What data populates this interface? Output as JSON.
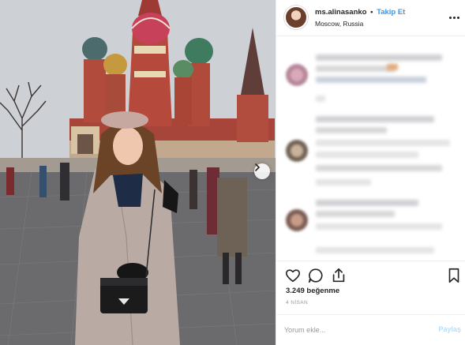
{
  "post": {
    "username": "ms.alinasanko",
    "separator": "•",
    "follow_label": "Takip Et",
    "location": "Moscow, Russia",
    "likes": "3.249 beğenme",
    "date": "4 NİSAN",
    "comment_placeholder": "Yorum ekle...",
    "post_label": "Paylaş"
  },
  "icons": {
    "heart": "heart-icon",
    "comment": "comment-icon",
    "share": "share-icon",
    "bookmark": "bookmark-icon",
    "more": "more-options-icon",
    "next": "chevron-right-icon"
  },
  "colors": {
    "follow": "#3897f0",
    "post_disabled": "#b2dffc",
    "text": "#262626",
    "muted": "#999999",
    "border": "#efefef"
  }
}
